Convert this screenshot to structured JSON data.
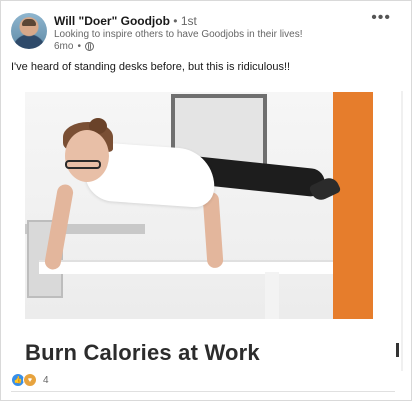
{
  "post": {
    "author": {
      "name": "Will \"Doer\" Goodjob",
      "degree": "1st",
      "separator": "•",
      "headline": "Looking to inspire others to have Goodjobs in their lives!",
      "time": "6mo",
      "time_separator": "•"
    },
    "more_label": "•••",
    "text": "I've heard of standing desks before, but this is ridiculous!!",
    "article": {
      "title": "Burn Calories at Work"
    },
    "reactions": {
      "count": "4",
      "types": [
        "like-icon",
        "support-icon"
      ]
    }
  },
  "colors": {
    "accent_orange": "#e67d2c",
    "like_blue": "#378fe9",
    "support_gold": "#e7a33e",
    "muted_text": "#666666"
  }
}
